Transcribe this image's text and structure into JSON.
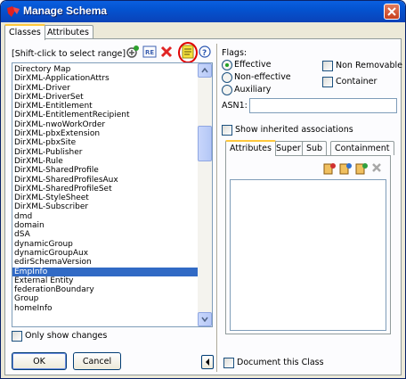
{
  "window": {
    "title": "Manage Schema"
  },
  "tabs": [
    {
      "label": "Classes"
    },
    {
      "label": "Attributes"
    }
  ],
  "classes": {
    "hint": "[Shift-click to select range]",
    "toolbar": [
      "add-class-icon",
      "rename-class-icon",
      "delete-class-icon",
      "properties-icon",
      "help-icon"
    ],
    "items": [
      "Directory Map",
      "DirXML-ApplicationAttrs",
      "DirXML-Driver",
      "DirXML-DriverSet",
      "DirXML-Entitlement",
      "DirXML-EntitlementRecipient",
      "DirXML-nwoWorkOrder",
      "DirXML-pbxExtension",
      "DirXML-pbxSite",
      "DirXML-Publisher",
      "DirXML-Rule",
      "DirXML-SharedProfile",
      "DirXML-SharedProfilesAux",
      "DirXML-SharedProfileSet",
      "DirXML-StyleSheet",
      "DirXML-Subscriber",
      "dmd",
      "domain",
      "dSA",
      "dynamicGroup",
      "dynamicGroupAux",
      "edirSchemaVersion",
      "EmpInfo",
      "External Entity",
      "federationBoundary",
      "Group",
      "homeInfo"
    ],
    "selected_item": "EmpInfo",
    "only_show_changes": "Only show changes",
    "ok_label": "OK",
    "cancel_label": "Cancel"
  },
  "details": {
    "flags_label": "Flags:",
    "effective": "Effective",
    "non_effective": "Non-effective",
    "auxiliary": "Auxiliary",
    "non_removable": "Non Removable",
    "container": "Container",
    "asn1_label": "ASN1:",
    "asn1_value": "",
    "show_inherited": "Show inherited associations",
    "subtabs": [
      "Attributes",
      "Super",
      "Sub",
      "Containment"
    ],
    "document_class": "Document this Class"
  },
  "colors": {
    "selection": "#316ac5",
    "titlebar": "#0453d0",
    "highlight_ring": "#e00000"
  }
}
